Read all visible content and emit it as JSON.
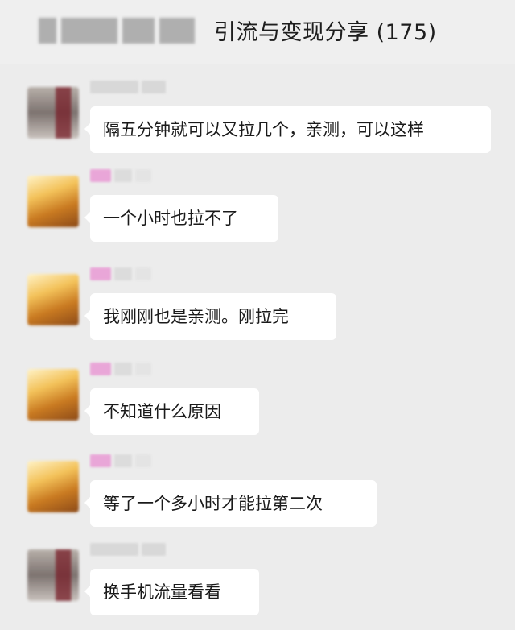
{
  "header": {
    "title": "引流与变现分享 (175)",
    "back_label_blurred": true
  },
  "messages": [
    {
      "avatar": "gray-avatar",
      "nickname_color": "gray",
      "text": "隔五分钟就可以又拉几个，亲测，可以这样"
    },
    {
      "avatar": "gold-avatar",
      "nickname_color": "pink",
      "text": "一个小时也拉不了"
    },
    {
      "avatar": "gold-avatar",
      "nickname_color": "pink",
      "text": "我刚刚也是亲测。刚拉完"
    },
    {
      "avatar": "gold-avatar",
      "nickname_color": "pink",
      "text": "不知道什么原因"
    },
    {
      "avatar": "gold-avatar",
      "nickname_color": "pink",
      "text": "等了一个多小时才能拉第二次"
    },
    {
      "avatar": "gray-avatar",
      "nickname_color": "gray",
      "text": "换手机流量看看"
    }
  ],
  "colors": {
    "background": "#ececec",
    "bubble": "#ffffff",
    "text": "#1a1a1a"
  }
}
